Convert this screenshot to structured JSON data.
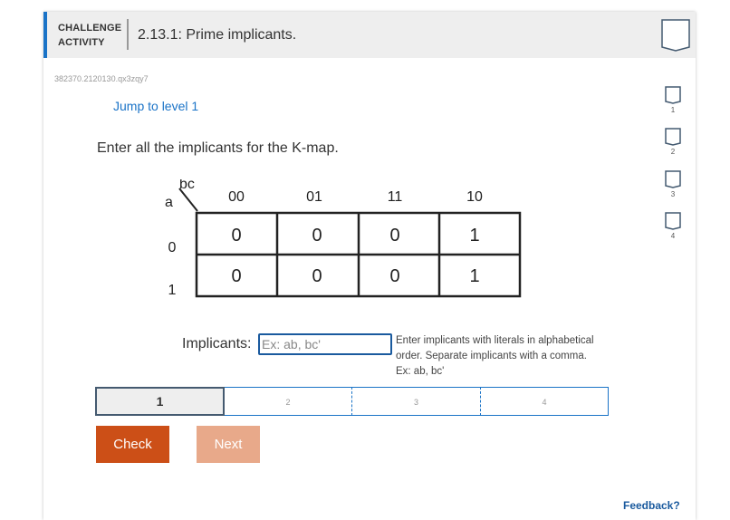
{
  "header": {
    "challenge_line1": "CHALLENGE",
    "challenge_line2": "ACTIVITY",
    "title": "2.13.1: Prime implicants.",
    "bookmark_icon": "bookmark-icon"
  },
  "activity_code": "382370.2120130.qx3zqy7",
  "jump_link": "Jump to level 1",
  "prompt": "Enter all the implicants for the K-map.",
  "kmap": {
    "corner_cols": "bc",
    "corner_rows": "a",
    "col_headers": [
      "00",
      "01",
      "11",
      "10"
    ],
    "row_headers": [
      "0",
      "1"
    ],
    "cells": [
      [
        "0",
        "0",
        "0",
        "1"
      ],
      [
        "0",
        "0",
        "0",
        "1"
      ]
    ]
  },
  "implicants": {
    "label": "Implicants:",
    "placeholder": "Ex: ab, bc'",
    "value": "",
    "help_line1": "Enter implicants with literals in alphabetical",
    "help_line2": "order. Separate implicants with a comma.",
    "help_line3": "Ex: ab, bc'"
  },
  "levels": [
    "1",
    "2",
    "3",
    "4"
  ],
  "buttons": {
    "check": "Check",
    "next": "Next"
  },
  "feedback": "Feedback?",
  "progress": [
    "1",
    "2",
    "3",
    "4"
  ],
  "colors": {
    "accent": "#1a73c7",
    "check": "#cc4f17",
    "next": "#e8a98a"
  }
}
